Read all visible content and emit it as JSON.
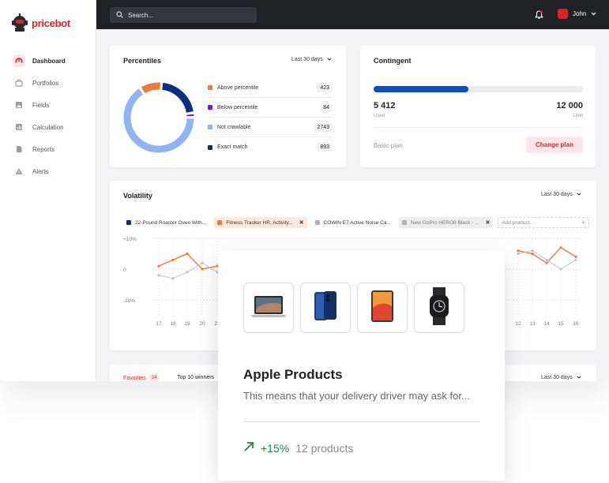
{
  "app": {
    "brand": "pricebot"
  },
  "sidebar": {
    "items": [
      {
        "label": "Dashboard",
        "icon": "gauge-icon",
        "active": true
      },
      {
        "label": "Portfolios",
        "icon": "briefcase-icon"
      },
      {
        "label": "Fields",
        "icon": "image-icon"
      },
      {
        "label": "Calculation",
        "icon": "bar-chart-icon"
      },
      {
        "label": "Reports",
        "icon": "document-icon"
      },
      {
        "label": "Alerts",
        "icon": "warning-icon"
      }
    ]
  },
  "topbar": {
    "search_placeholder": "Search...",
    "user_name": "John"
  },
  "percentiles": {
    "title": "Percentiles",
    "range": "Last 30 days",
    "legend": [
      {
        "label": "Above percentile",
        "value": "423",
        "color": "#f07a38"
      },
      {
        "label": "Below percentile",
        "value": "84",
        "color": "#8a12c8"
      },
      {
        "label": "Not crawlable",
        "value": "2743",
        "color": "#8fb3f5"
      },
      {
        "label": "Exact match",
        "value": "893",
        "color": "#0c2e80"
      }
    ],
    "chart_data": {
      "type": "pie",
      "categories": [
        "Above percentile",
        "Below percentile",
        "Not crawlable",
        "Exact match"
      ],
      "values": [
        423,
        84,
        2743,
        893
      ]
    }
  },
  "contingent": {
    "title": "Contingent",
    "used": "5 412",
    "used_label": "Used",
    "limit": "12 000",
    "limit_label": "Limit",
    "progress": 0.451,
    "plan": "Basic plan",
    "button": "Change plan"
  },
  "volatility": {
    "title": "Volatility",
    "range": "Last 30 days",
    "chips": [
      {
        "label": "22-Pound Roaster Oven With...",
        "color": "#0c2e80",
        "style": "plain"
      },
      {
        "label": "Fitness Tracker HR, Activity...",
        "color": "#f07a38",
        "style": "sel"
      },
      {
        "label": "COWIN E7 Active Noise Ca...",
        "color": "#b0b0b6",
        "style": "plain"
      },
      {
        "label": "New GoPro HERO9 Black - ...",
        "color": "#b0b0b6",
        "style": "gray"
      }
    ],
    "add_placeholder": "Add product...",
    "chart_data": {
      "type": "line",
      "y_ticks": [
        "+10%",
        "0",
        "-10%"
      ],
      "ylim": [
        -10,
        10
      ],
      "x_left": [
        "17",
        "18",
        "19",
        "20",
        "21"
      ],
      "x_right": [
        "12",
        "13",
        "14",
        "15",
        "16"
      ],
      "series": [
        {
          "color": "#f07a38",
          "left": [
            1,
            3,
            5,
            0,
            1
          ],
          "right": [
            6,
            5,
            2,
            7,
            4
          ]
        },
        {
          "color": "#b8c0d8",
          "left": [
            -2,
            -3,
            -1,
            2,
            -1
          ],
          "right": [
            5,
            6,
            3,
            0,
            3
          ]
        }
      ]
    }
  },
  "favorites": {
    "tab1": "Favorites",
    "tab1_count": "24",
    "tab2": "Top 10 winners",
    "range": "Last 30 days"
  },
  "product_card": {
    "products": [
      {
        "icon": "laptop-icon"
      },
      {
        "icon": "phone-icon"
      },
      {
        "icon": "tablet-icon"
      },
      {
        "icon": "watch-icon"
      }
    ],
    "title": "Apple Products",
    "description": "This means that your delivery driver may ask for...",
    "change": "+15%",
    "count": "12 products"
  }
}
